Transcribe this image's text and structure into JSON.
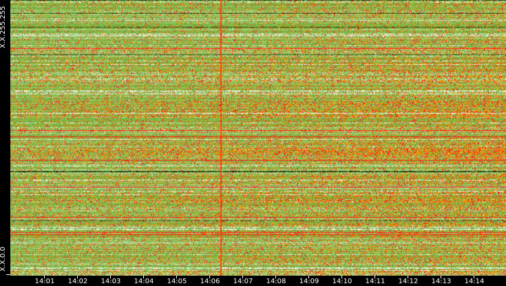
{
  "chart_data": {
    "type": "heatmap",
    "title": "",
    "xlabel": "",
    "ylabel": "",
    "x_ticks": [
      "14:01",
      "14:02",
      "14:03",
      "14:04",
      "14:05",
      "14:06",
      "14:07",
      "14:08",
      "14:09",
      "14:10",
      "14:11",
      "14:12",
      "14:13",
      "14:14"
    ],
    "y_labels": [
      "X.X.255.255",
      "X.X.0.0"
    ],
    "x_range": [
      "14:00:10",
      "14:14:50"
    ],
    "y_range": [
      "X.X.0.0",
      "X.X.255.255"
    ],
    "color_scale": [
      "#ffffff",
      "#9ccf7e",
      "#78b84a",
      "#5e9e2a",
      "#c8b400",
      "#f59a00",
      "#ff5a00",
      "#ff1a1a",
      "#1a3a10"
    ],
    "grid": false,
    "legend": "none"
  }
}
